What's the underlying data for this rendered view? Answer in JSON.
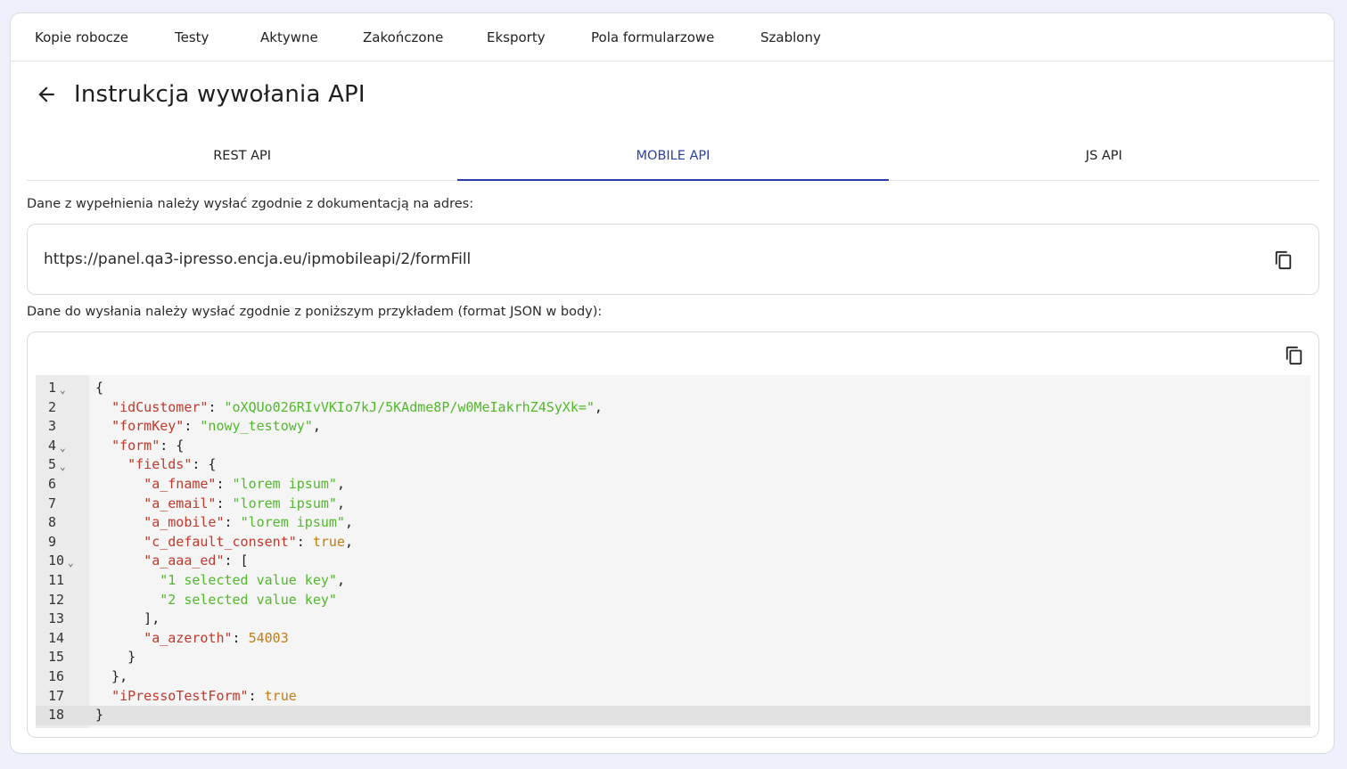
{
  "topnav": {
    "items": [
      {
        "label": "Kopie robocze"
      },
      {
        "label": "Testy"
      },
      {
        "label": "Aktywne"
      },
      {
        "label": "Zakończone"
      },
      {
        "label": "Eksporty"
      },
      {
        "label": "Pola formularzowe"
      },
      {
        "label": "Szablony"
      }
    ]
  },
  "header": {
    "title": "Instrukcja wywołania API",
    "back_icon": "arrow-left-icon"
  },
  "tabs": [
    {
      "label": "REST API",
      "active": false
    },
    {
      "label": "MOBILE API",
      "active": true
    },
    {
      "label": "JS API",
      "active": false
    }
  ],
  "endpoint": {
    "label": "Dane z wypełnienia należy wysłać zgodnie z dokumentacją na adres:",
    "url": "https://panel.qa3-ipresso.encja.eu/ipmobileapi/2/formFill",
    "copy_icon": "copy-icon"
  },
  "payload": {
    "label": "Dane do wysłania należy wysłać zgodnie z poniższym przykładem (format JSON w body):",
    "copy_icon": "copy-icon",
    "active_line": 18,
    "lines": [
      {
        "n": "1",
        "fold": true,
        "code": "{"
      },
      {
        "n": "2",
        "fold": false,
        "code": "  \"idCustomer\": \"oXQUo026RIvVKIo7kJ/5KAdme8P/w0MeIakrhZ4SyXk=\","
      },
      {
        "n": "3",
        "fold": false,
        "code": "  \"formKey\": \"nowy_testowy\","
      },
      {
        "n": "4",
        "fold": true,
        "code": "  \"form\": {"
      },
      {
        "n": "5",
        "fold": true,
        "code": "    \"fields\": {"
      },
      {
        "n": "6",
        "fold": false,
        "code": "      \"a_fname\": \"lorem ipsum\","
      },
      {
        "n": "7",
        "fold": false,
        "code": "      \"a_email\": \"lorem ipsum\","
      },
      {
        "n": "8",
        "fold": false,
        "code": "      \"a_mobile\": \"lorem ipsum\","
      },
      {
        "n": "9",
        "fold": false,
        "code": "      \"c_default_consent\": true,"
      },
      {
        "n": "10",
        "fold": true,
        "code": "      \"a_aaa_ed\": ["
      },
      {
        "n": "11",
        "fold": false,
        "code": "        \"1 selected value key\","
      },
      {
        "n": "12",
        "fold": false,
        "code": "        \"2 selected value key\""
      },
      {
        "n": "13",
        "fold": false,
        "code": "      ],"
      },
      {
        "n": "14",
        "fold": false,
        "code": "      \"a_azeroth\": 54003"
      },
      {
        "n": "15",
        "fold": false,
        "code": "    }"
      },
      {
        "n": "16",
        "fold": false,
        "code": "  },"
      },
      {
        "n": "17",
        "fold": false,
        "code": "  \"iPressoTestForm\": true"
      },
      {
        "n": "18",
        "fold": false,
        "code": "}"
      }
    ]
  },
  "colors": {
    "accent": "#2b3ea8",
    "json_key": "#c0392b",
    "json_string": "#52b82c",
    "json_literal": "#c47d0e"
  }
}
